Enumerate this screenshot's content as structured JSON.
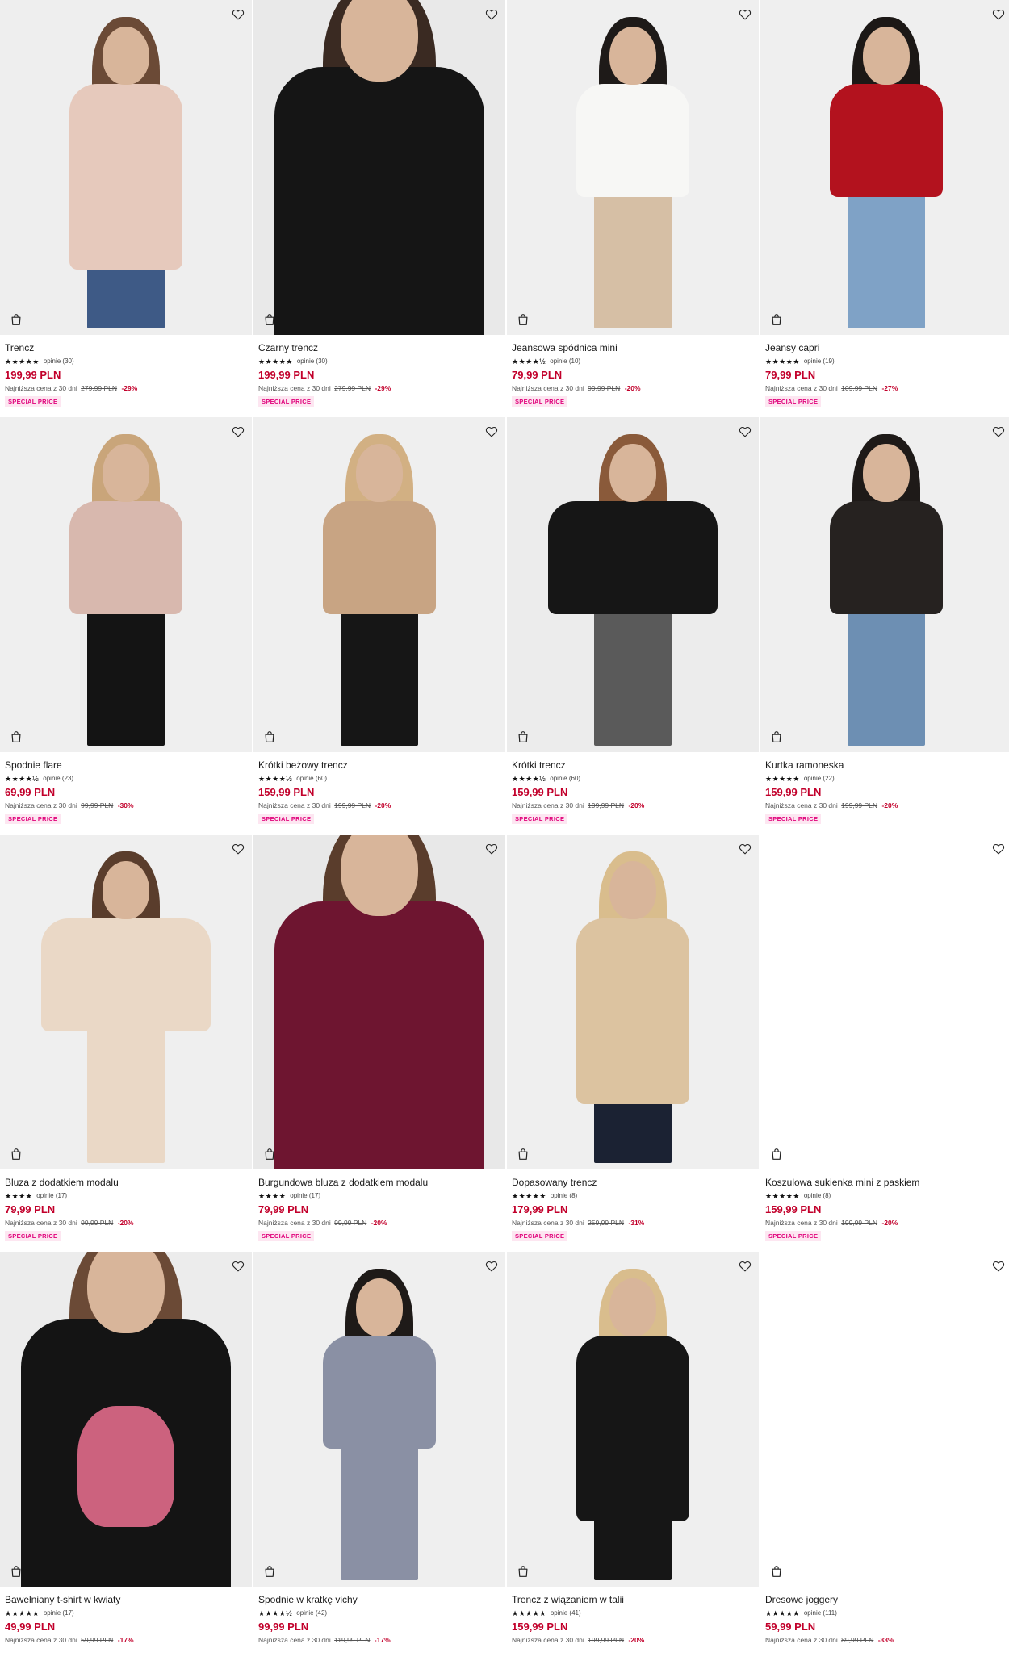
{
  "labels": {
    "lowest_price_prefix": "Najniższa cena z 30 dni"
  },
  "products": [
    {
      "name": "Trencz",
      "stars": "★★★★★",
      "reviews": "opinie (30)",
      "price": "199,99 PLN",
      "old_price": "279,99 PLN",
      "discount": "-29%",
      "badge": "SPECIAL PRICE",
      "look": {
        "bg": "#eeeeee",
        "hair": "#6b4a36",
        "top": "#e6c9bc",
        "bottom": "#3e5a86",
        "style": "long"
      }
    },
    {
      "name": "Czarny trencz",
      "stars": "★★★★★",
      "reviews": "opinie (30)",
      "price": "199,99 PLN",
      "old_price": "279,99 PLN",
      "discount": "-29%",
      "badge": "SPECIAL PRICE",
      "look": {
        "bg": "#e9e9e9",
        "hair": "#3a2a22",
        "top": "#151515",
        "bottom": "#151515",
        "style": "close"
      }
    },
    {
      "name": "Jeansowa spódnica mini",
      "stars": "★★★★½",
      "reviews": "opinie (10)",
      "price": "79,99 PLN",
      "old_price": "99,99 PLN",
      "discount": "-20%",
      "badge": "SPECIAL PRICE",
      "look": {
        "bg": "#efefef",
        "hair": "#1e1a18",
        "top": "#f7f7f5",
        "bottom": "#d6bfa5",
        "style": ""
      }
    },
    {
      "name": "Jeansy capri",
      "stars": "★★★★★",
      "reviews": "opinie (19)",
      "price": "79,99 PLN",
      "old_price": "109,99 PLN",
      "discount": "-27%",
      "badge": "SPECIAL PRICE",
      "look": {
        "bg": "#efefef",
        "hair": "#1c1816",
        "top": "#b3121e",
        "bottom": "#7fa2c6",
        "style": ""
      }
    },
    {
      "name": "Spodnie flare",
      "stars": "★★★★½",
      "reviews": "opinie (23)",
      "price": "69,99 PLN",
      "old_price": "99,99 PLN",
      "discount": "-30%",
      "badge": "SPECIAL PRICE",
      "look": {
        "bg": "#efefef",
        "hair": "#c9a57a",
        "top": "#d8b8ae",
        "bottom": "#141414",
        "style": ""
      }
    },
    {
      "name": "Krótki beżowy trencz",
      "stars": "★★★★½",
      "reviews": "opinie (60)",
      "price": "159,99 PLN",
      "old_price": "199,99 PLN",
      "discount": "-20%",
      "badge": "SPECIAL PRICE",
      "look": {
        "bg": "#efefef",
        "hair": "#d2b083",
        "top": "#c8a483",
        "bottom": "#161616",
        "style": ""
      }
    },
    {
      "name": "Krótki trencz",
      "stars": "★★★★½",
      "reviews": "opinie (60)",
      "price": "159,99 PLN",
      "old_price": "199,99 PLN",
      "discount": "-20%",
      "badge": "SPECIAL PRICE",
      "look": {
        "bg": "#ececec",
        "hair": "#8a5a3a",
        "top": "#161616",
        "bottom": "#5a5a5a",
        "style": "wide"
      }
    },
    {
      "name": "Kurtka ramoneska",
      "stars": "★★★★★",
      "reviews": "opinie (22)",
      "price": "159,99 PLN",
      "old_price": "199,99 PLN",
      "discount": "-20%",
      "badge": "SPECIAL PRICE",
      "look": {
        "bg": "#efefef",
        "hair": "#1e1a18",
        "top": "#262220",
        "bottom": "#6d8fb3",
        "style": ""
      }
    },
    {
      "name": "Bluza z dodatkiem modalu",
      "stars": "★★★★",
      "reviews": "opinie (17)",
      "price": "79,99 PLN",
      "old_price": "99,99 PLN",
      "discount": "-20%",
      "badge": "SPECIAL PRICE",
      "look": {
        "bg": "#efefef",
        "hair": "#5a3d2c",
        "top": "#ead8c6",
        "bottom": "#ead8c6",
        "style": "wide"
      }
    },
    {
      "name": "Burgundowa bluza z dodatkiem modalu",
      "stars": "★★★★",
      "reviews": "opinie (17)",
      "price": "79,99 PLN",
      "old_price": "99,99 PLN",
      "discount": "-20%",
      "badge": "SPECIAL PRICE",
      "look": {
        "bg": "#e8e8e8",
        "hair": "#5a3d2c",
        "top": "#6e1530",
        "bottom": "#6e1530",
        "style": "close"
      }
    },
    {
      "name": "Dopasowany trencz",
      "stars": "★★★★★",
      "reviews": "opinie (8)",
      "price": "179,99 PLN",
      "old_price": "259,99 PLN",
      "discount": "-31%",
      "badge": "SPECIAL PRICE",
      "look": {
        "bg": "#efefef",
        "hair": "#d9bd8d",
        "top": "#dcc3a0",
        "bottom": "#1b2233",
        "style": "long"
      }
    },
    {
      "name": "Koszulowa sukienka mini z paskiem",
      "stars": "★★★★★",
      "reviews": "opinie (8)",
      "price": "159,99 PLN",
      "old_price": "199,99 PLN",
      "discount": "-20%",
      "badge": "SPECIAL PRICE",
      "look": {
        "bg": "#ffffff",
        "hair": "",
        "top": "",
        "bottom": "",
        "style": "empty"
      }
    },
    {
      "name": "Bawełniany t-shirt w kwiaty",
      "stars": "★★★★★",
      "reviews": "opinie (17)",
      "price": "49,99 PLN",
      "old_price": "59,99 PLN",
      "discount": "-17%",
      "badge": "",
      "look": {
        "bg": "#ececec",
        "hair": "#6b4a36",
        "top": "#141414",
        "bottom": "#7fa2c6",
        "style": "close",
        "print": "#e06a8a"
      }
    },
    {
      "name": "Spodnie w kratkę vichy",
      "stars": "★★★★½",
      "reviews": "opinie (42)",
      "price": "99,99 PLN",
      "old_price": "119,99 PLN",
      "discount": "-17%",
      "badge": "",
      "look": {
        "bg": "#efefef",
        "hair": "#1e1a18",
        "top": "#8a90a4",
        "bottom": "#8a90a4",
        "style": ""
      }
    },
    {
      "name": "Trencz z wiązaniem w talii",
      "stars": "★★★★★",
      "reviews": "opinie (41)",
      "price": "159,99 PLN",
      "old_price": "199,99 PLN",
      "discount": "-20%",
      "badge": "",
      "look": {
        "bg": "#efefef",
        "hair": "#d9bd8d",
        "top": "#161616",
        "bottom": "#161616",
        "style": "long"
      }
    },
    {
      "name": "Dresowe joggery",
      "stars": "★★★★★",
      "reviews": "opinie (111)",
      "price": "59,99 PLN",
      "old_price": "89,99 PLN",
      "discount": "-33%",
      "badge": "",
      "look": {
        "bg": "#ffffff",
        "hair": "",
        "top": "",
        "bottom": "",
        "style": "empty"
      }
    }
  ]
}
